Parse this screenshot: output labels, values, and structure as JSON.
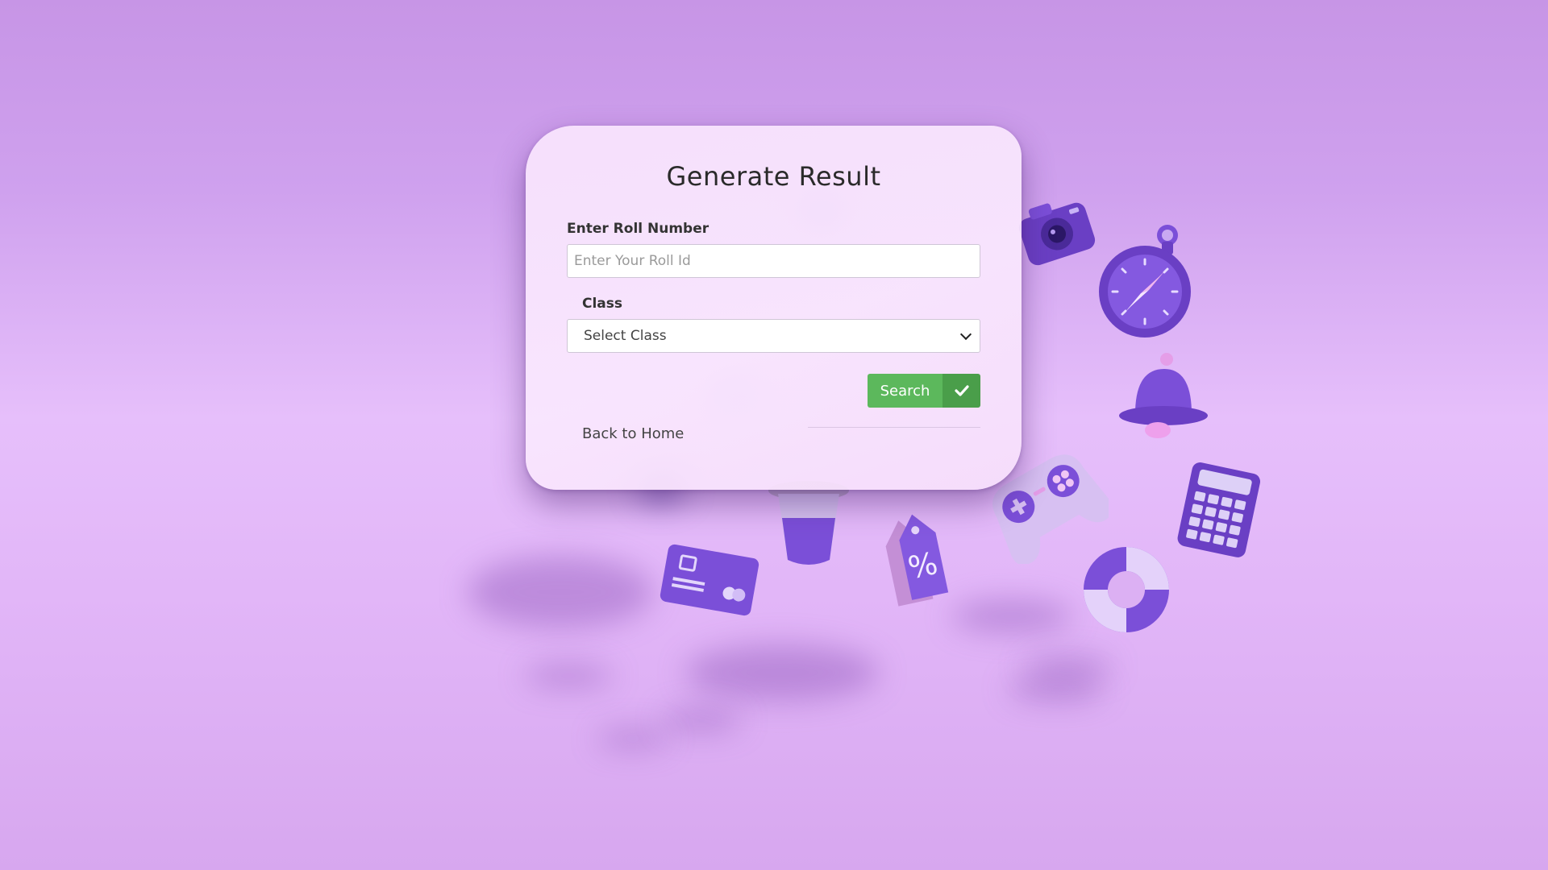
{
  "form": {
    "title": "Generate Result",
    "roll_label": "Enter Roll Number",
    "roll_placeholder": "Enter Your Roll Id",
    "roll_value": "",
    "class_label": "Class",
    "class_selected": "Select Class",
    "search_label": "Search",
    "search_icon": "check-icon",
    "back_link": "Back to Home"
  },
  "colors": {
    "background_top": "#c795e6",
    "background_mid": "#e6bffb",
    "card": "#f8e4fd",
    "accent_purple": "#7b4fd8",
    "button_green": "#5cb85c",
    "button_green_dark": "#4a9e4a"
  },
  "decorations": [
    "camera-icon",
    "compass-icon",
    "bell-icon",
    "gamepad-icon",
    "calculator-icon",
    "lifebuoy-icon",
    "credit-card-icon",
    "discount-tag-icon",
    "cup-icon"
  ]
}
